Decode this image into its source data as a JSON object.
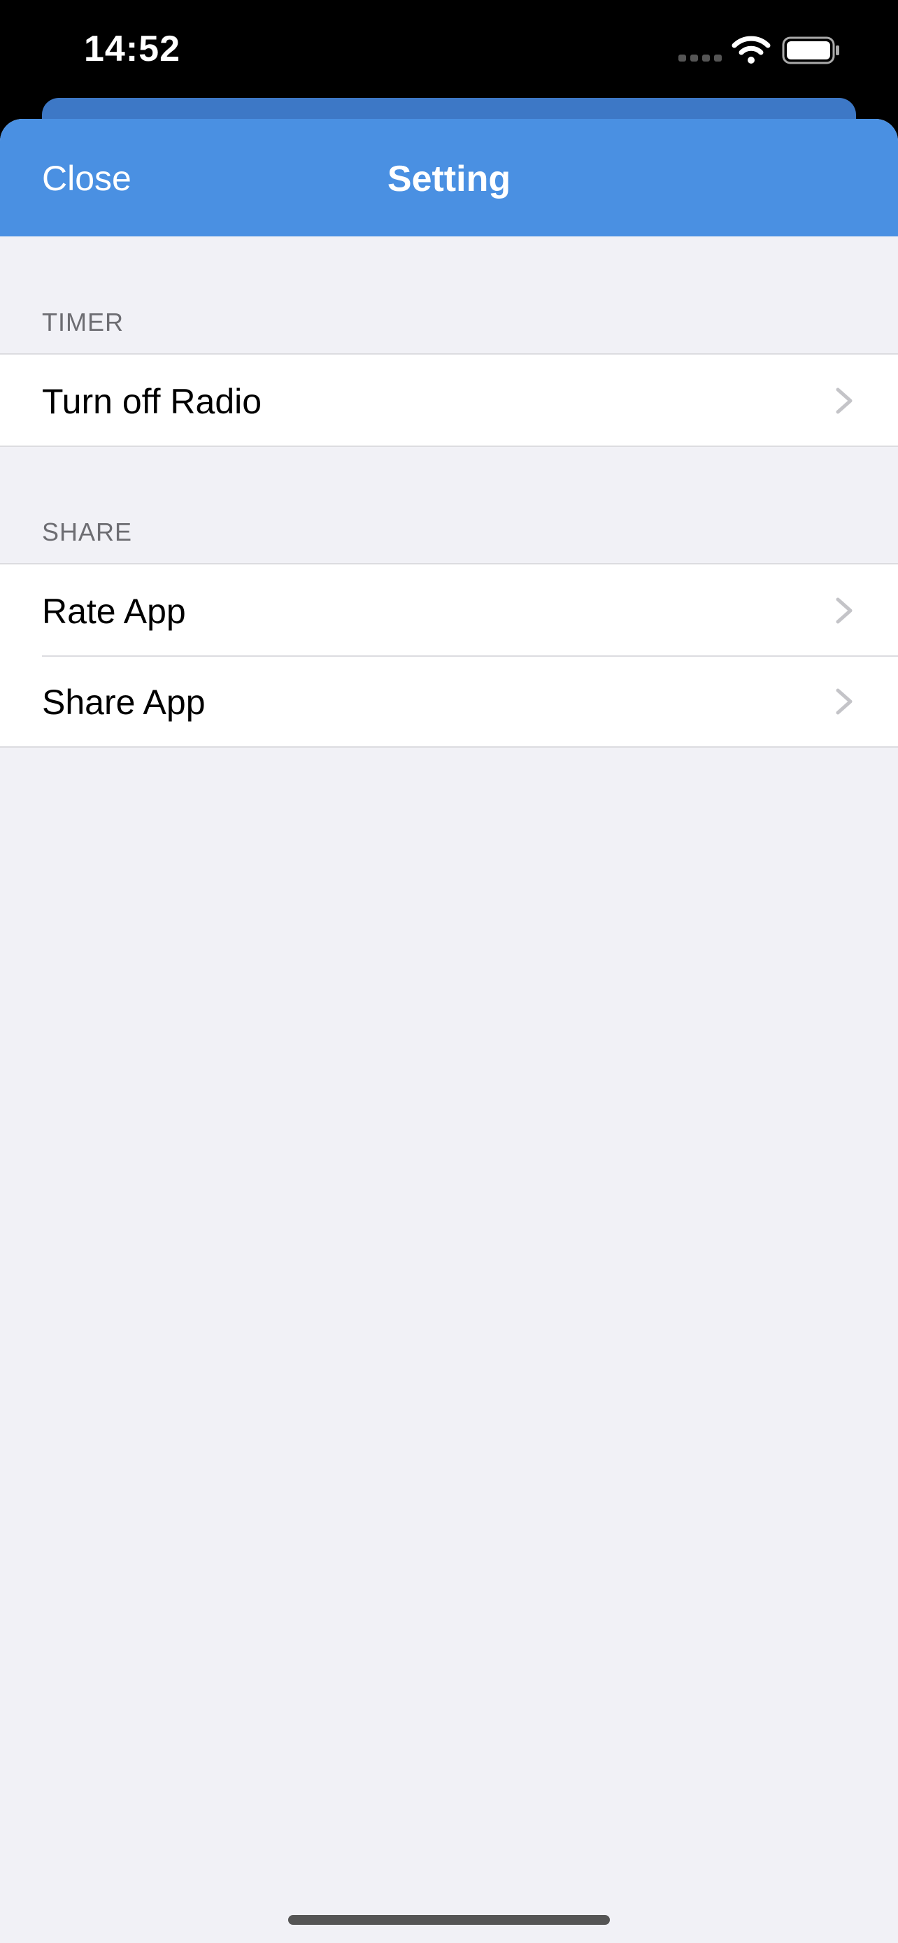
{
  "status_bar": {
    "time": "14:52",
    "icons": [
      "signal-icon",
      "wifi-icon",
      "battery-icon"
    ]
  },
  "nav": {
    "close_label": "Close",
    "title": "Setting",
    "color": "#4a90e2"
  },
  "sections": [
    {
      "header": "TIMER",
      "rows": [
        {
          "label": "Turn off Radio",
          "icon": "chevron-right-icon"
        }
      ]
    },
    {
      "header": "SHARE",
      "rows": [
        {
          "label": "Rate App",
          "icon": "chevron-right-icon"
        },
        {
          "label": "Share App",
          "icon": "chevron-right-icon"
        }
      ]
    }
  ],
  "colors": {
    "background": "#f1f1f6",
    "header_text": "#6d6d72",
    "chevron": "#c4c4c8"
  }
}
